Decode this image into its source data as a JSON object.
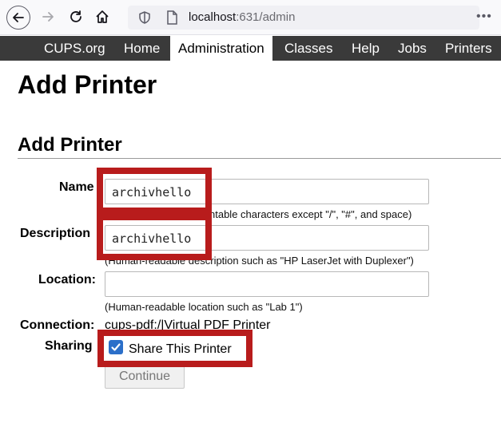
{
  "browser": {
    "url_host": "localhost",
    "url_path": ":631/admin"
  },
  "cups_nav": {
    "tabs": [
      {
        "label": "CUPS.org"
      },
      {
        "label": "Home"
      },
      {
        "label": "Administration",
        "active": true
      },
      {
        "label": "Classes"
      },
      {
        "label": "Help"
      },
      {
        "label": "Jobs"
      },
      {
        "label": "Printers"
      }
    ]
  },
  "page": {
    "title": "Add Printer",
    "section_title": "Add Printer"
  },
  "form": {
    "name_label": "Name",
    "name_value": "archivhello",
    "name_hint": "ntable characters except \"/\", \"#\", and space)",
    "description_label": "Description",
    "description_value": "archivhello",
    "description_hint": "(Human-readable description such as \"HP LaserJet with Duplexer\")",
    "location_label": "Location:",
    "location_value": "",
    "location_hint": "(Human-readable location such as \"Lab 1\")",
    "connection_label": "Connection:",
    "connection_value": "cups-pdf:/|Virtual PDF Printer",
    "sharing_label": "Sharing",
    "sharing_checkbox_label": "Share This Printer",
    "sharing_checked": true,
    "continue_label": "Continue"
  },
  "colors": {
    "highlight": "#b81c1c",
    "nav_bg": "#3a3a3a",
    "checkbox": "#2b6fc9"
  }
}
